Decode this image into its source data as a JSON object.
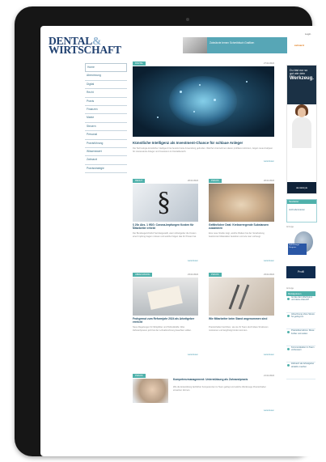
{
  "brand": {
    "line1": "DENTAL",
    "amp": "&",
    "line2": "WIRTSCHAFT"
  },
  "top_link": "Login",
  "top_ad": {
    "text": "Zahnärzte lernen Schreibtisch Grafiken",
    "badge": "zahnarzt"
  },
  "nav": [
    "Home",
    "Abrechnung",
    "Digital",
    "Recht",
    "Praxis",
    "Finanzen",
    "Marke",
    "Steuern",
    "Personal",
    "Praxisführung",
    "Wissenswert",
    "Zahnarzt",
    "Praxisstrategie"
  ],
  "hero": {
    "tag": "DIGITAL",
    "date": "27.02.2024",
    "headline": "Künstliche Intelligenz als Investment-Chance für schlaue Anleger",
    "body": "Die Technologie künstlicher Intelligenz hat bereits breite Anwendung gefunden. Welche Unternehmen davon profitieren könnten, zeigen neue Analysen für interessierte Anleger und Investoren im Dentalbereich.",
    "more": "weiterlesen"
  },
  "cards": [
    {
      "tag": "RECHT",
      "date": "26.02.2024",
      "headline": "§ 20c Abs. 1 IfSG: Corona-Impfungen Kosten für Mitarbeiter erhebt",
      "body": "Der Bundesgerichtshof hat klargestellt, wann Arbeitgeber die Kosten einer Impfung tragen müssen und welche Folgen das für Praxen hat.",
      "more": "weiterlesen"
    },
    {
      "tag": "PRAXIS",
      "date": "26.02.2024",
      "headline": "Gefährlicher Deal: Krebserregende Substanzen zusammen",
      "body": "Eine neue Studie zeigt, welche Risiken bei der Verarbeitung bestimmter Materialien bestehen und wie man vorbeugt.",
      "more": "weiterlesen"
    },
    {
      "tag": "ABRECHNUNG",
      "date": "23.02.2024",
      "headline": "Frohgemut zum Reformjahr 2024 als Arbeitgeber erreicht",
      "body": "Neue Regelungen für Minijobber und Teilzeitkräfte: Was Zahnarztpraxen jetzt bei der Lohnabrechnung beachten sollten.",
      "more": "weiterlesen"
    },
    {
      "tag": "PRAXIS",
      "date": "23.02.2024",
      "headline": "Wie Mitarbeiter beim Stand angenommen sind",
      "body": "Praxisinhaber berichten, wie sie ihr Team durch klare Strukturen motivieren und langfristig binden konnten.",
      "more": "weiterlesen"
    }
  ],
  "wide": {
    "tag": "PRAXIS",
    "date": "21.02.2024",
    "headline": "Kompetenzmanagement: Unterstützung als Zahnarztpraxis",
    "body": "Wie die Entwicklung fachlicher Kompetenzen im Team gelingt und welche Werkzeuge Praxisinhaber einsetzen können.",
    "more": "weiterlesen"
  },
  "sidebar_ad": {
    "line1": "Du bist nur so",
    "line2": "gut wie dein",
    "big": "Werkzeug.",
    "foot": "dentalstyle"
  },
  "newsletter": {
    "head": "Newsletter",
    "link": "Jetzt abonnieren"
  },
  "ad2": {
    "label": "Anzeige",
    "blue": "Implantologie Kongress",
    "dark": "Profil"
  },
  "popular": {
    "label": "Anzeige",
    "head": "Meistgelesen",
    "items": [
      "Ist das dein Wachstum und deine Zukunft?",
      "Abrechnung ohne Stress: So gelingt es",
      "Praxisübernahme: Diese Fehler vermeiden",
      "Kommunikation im Team verbessern",
      "Zahnarzt als Arbeitgeber attraktiv machen"
    ]
  },
  "colors": {
    "accent": "#4fb1ab",
    "brand": "#1e3f6f",
    "frame": "#161616"
  }
}
